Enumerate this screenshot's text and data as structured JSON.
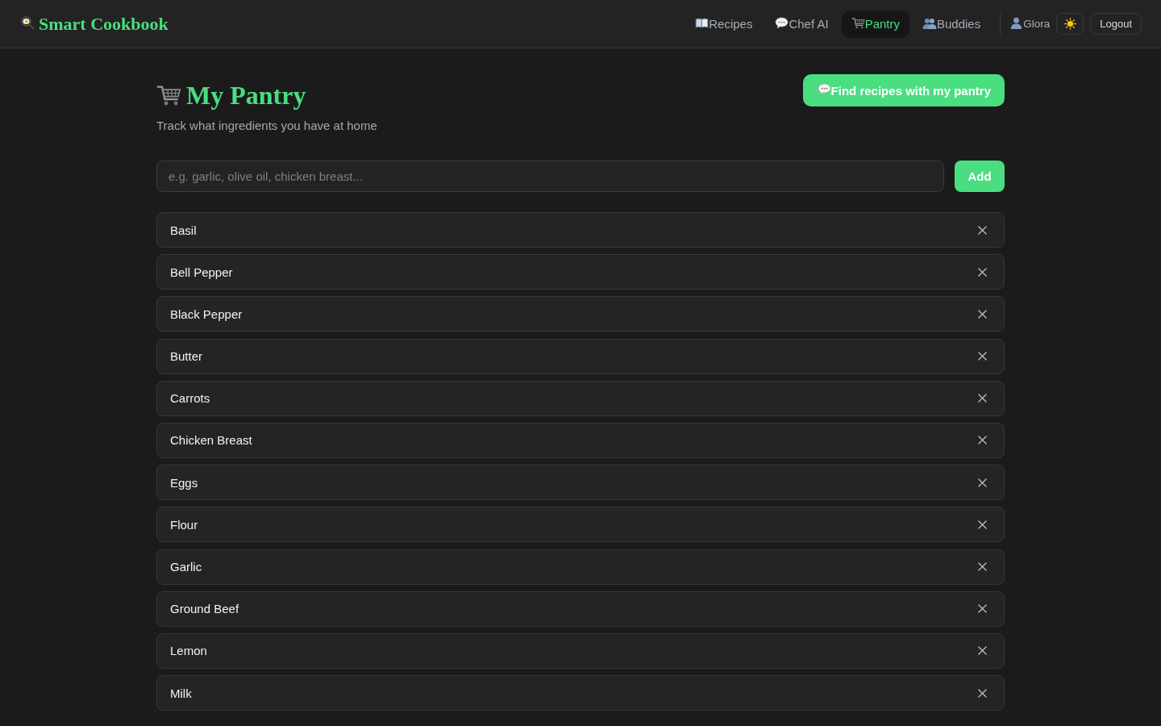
{
  "header": {
    "logo": "Smart Cookbook",
    "nav": [
      {
        "label": "Recipes",
        "selected": false
      },
      {
        "label": "Chef AI",
        "selected": false
      },
      {
        "label": "Pantry",
        "selected": true
      },
      {
        "label": "Buddies",
        "selected": false
      }
    ],
    "user": "Glora",
    "logout": "Logout"
  },
  "page": {
    "title": "My Pantry",
    "subtitle": "Track what ingredients you have at home",
    "find_button": "Find recipes with my pantry",
    "input": {
      "placeholder": "e.g. garlic, olive oil, chicken breast..."
    },
    "add_button": "Add",
    "items": [
      {
        "name": "Basil"
      },
      {
        "name": "Bell Pepper"
      },
      {
        "name": "Black Pepper"
      },
      {
        "name": "Butter"
      },
      {
        "name": "Carrots"
      },
      {
        "name": "Chicken Breast"
      },
      {
        "name": "Eggs"
      },
      {
        "name": "Flour"
      },
      {
        "name": "Garlic"
      },
      {
        "name": "Ground Beef"
      },
      {
        "name": "Lemon"
      },
      {
        "name": "Milk"
      }
    ]
  }
}
